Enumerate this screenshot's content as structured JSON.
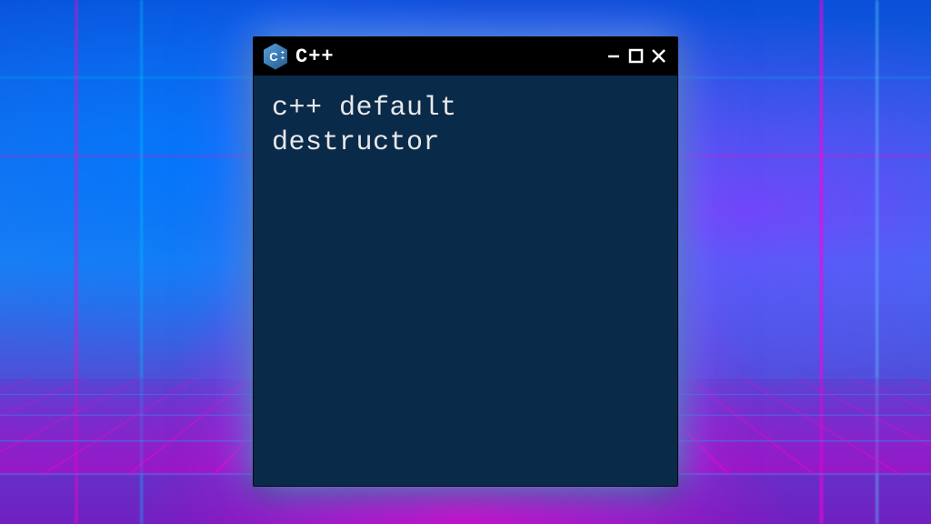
{
  "window": {
    "title": "C++",
    "icon_name": "cpp-logo-icon"
  },
  "terminal": {
    "content": "c++ default\ndestructor"
  },
  "colors": {
    "terminal_bg": "#0a2a4a",
    "titlebar_bg": "#000000",
    "text": "#e8e8e8"
  }
}
